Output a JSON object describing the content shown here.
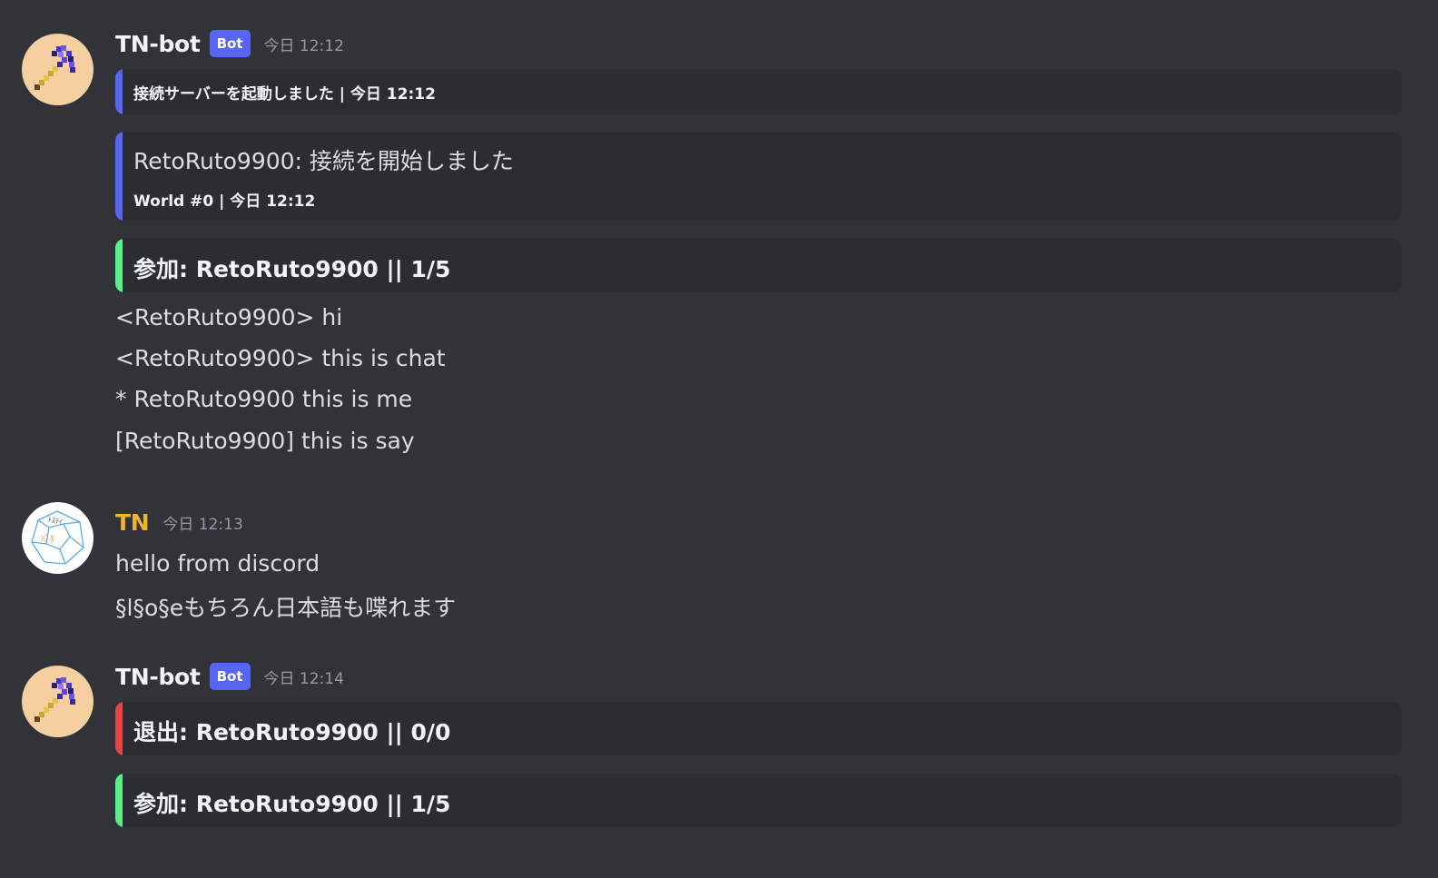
{
  "colors": {
    "background": "#313338",
    "embed_background": "#2b2d31",
    "blue_bar": "#5865f2",
    "green_bar": "#57f287",
    "red_bar": "#ed4245",
    "bot_tag": "#5865f2",
    "tn_name": "#f0b232"
  },
  "messages": [
    {
      "author": "TN-bot",
      "bot_tag": "Bot",
      "timestamp": "今日 12:12",
      "avatar_icon": "pickaxe-icon",
      "embeds": [
        {
          "color": "blue",
          "footer": "接続サーバーを起動しました | 今日 12:12"
        },
        {
          "color": "blue",
          "title": "RetoRuto9900: 接続を開始しました",
          "footer": "World #0 | 今日 12:12"
        },
        {
          "color": "green",
          "author": "参加: RetoRuto9900 || 1/5"
        }
      ],
      "lines": [
        "<RetoRuto9900> hi",
        "<RetoRuto9900> this is chat",
        "* RetoRuto9900 this is me",
        "[RetoRuto9900] this is say"
      ]
    },
    {
      "author": "TN",
      "timestamp": "今日 12:13",
      "avatar_icon": "dodecahedron-icon",
      "lines": [
        "hello from discord",
        "§l§o§eもちろん日本語も喋れます"
      ]
    },
    {
      "author": "TN-bot",
      "bot_tag": "Bot",
      "timestamp": "今日 12:14",
      "avatar_icon": "pickaxe-icon",
      "embeds": [
        {
          "color": "red",
          "author": "退出: RetoRuto9900 || 0/0"
        },
        {
          "color": "green",
          "author": "参加: RetoRuto9900 || 1/5"
        }
      ]
    }
  ]
}
